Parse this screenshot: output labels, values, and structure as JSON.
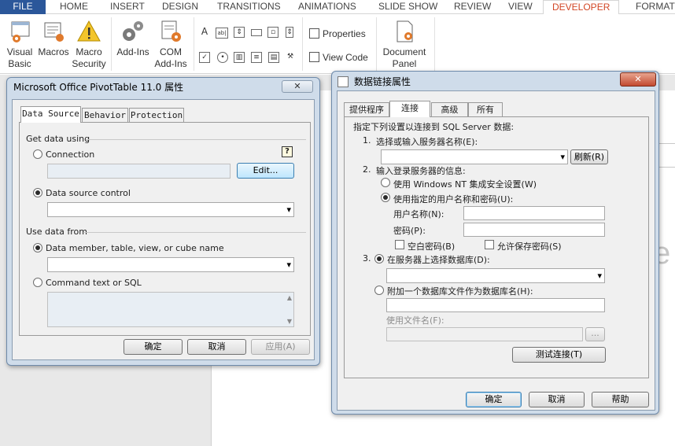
{
  "ribbon": {
    "tabs": [
      "FILE",
      "HOME",
      "INSERT",
      "DESIGN",
      "TRANSITIONS",
      "ANIMATIONS",
      "SLIDE SHOW",
      "REVIEW",
      "VIEW",
      "DEVELOPER",
      "FORMAT"
    ],
    "active_tab": "DEVELOPER",
    "buttons": {
      "visual_basic": [
        "Visual",
        "Basic"
      ],
      "macros": "Macros",
      "macro_security": [
        "Macro",
        "Security"
      ],
      "add_ins": "Add-Ins",
      "com_add_ins": [
        "COM",
        "Add-Ins"
      ],
      "properties": "Properties",
      "view_code": "View Code",
      "document_panel": [
        "Document",
        "Panel"
      ]
    }
  },
  "pivot_dialog": {
    "title": "Microsoft Office PivotTable 11.0 属性",
    "tabs": [
      "Data Source",
      "Behavior",
      "Protection"
    ],
    "get_data_group": "Get data using",
    "connection_label": "Connection",
    "edit_button": "Edit...",
    "help_glyph": "?",
    "data_source_control_label": "Data source control",
    "use_data_group": "Use data from",
    "data_member_label": "Data member, table, view, or cube name",
    "command_text_label": "Command text or SQL",
    "ok_button": "确定",
    "cancel_button": "取消",
    "apply_button": "应用(A)"
  },
  "datalink_dialog": {
    "title": "数据链接属性",
    "tabs": [
      "提供程序",
      "连接",
      "高级",
      "所有"
    ],
    "intro": "指定下列设置以连接到 SQL Server 数据:",
    "step1_num": "1.",
    "step1": "选择或输入服务器名称(E):",
    "refresh_button": "刷新(R)",
    "step2_num": "2.",
    "step2": "输入登录服务器的信息:",
    "nt_security": "使用 Windows NT 集成安全设置(W)",
    "specific_user": "使用指定的用户名称和密码(U):",
    "username_label": "用户名称(N):",
    "password_label": "密码(P):",
    "blank_password": "空白密码(B)",
    "allow_save_password": "允许保存密码(S)",
    "step3_num": "3.",
    "select_db": "在服务器上选择数据库(D):",
    "attach_db": "附加一个数据库文件作为数据库名(H):",
    "use_filename": "使用文件名(F):",
    "browse_button": "...",
    "test_button": "测试连接(T)",
    "ok_button": "确定",
    "cancel_button": "取消",
    "help_button": "帮助"
  },
  "colors": {
    "file_tab": "#2b579a",
    "active_tab_text": "#d24726",
    "dialog_frame": "#cfdcea",
    "close_button": "#c24930"
  },
  "icons": [
    "visual-basic-icon",
    "macros-icon",
    "macro-security-icon",
    "add-ins-icon",
    "com-add-ins-icon",
    "properties-icon",
    "view-code-icon",
    "document-panel-icon",
    "close-icon",
    "help-icon",
    "dialog-app-icon"
  ]
}
